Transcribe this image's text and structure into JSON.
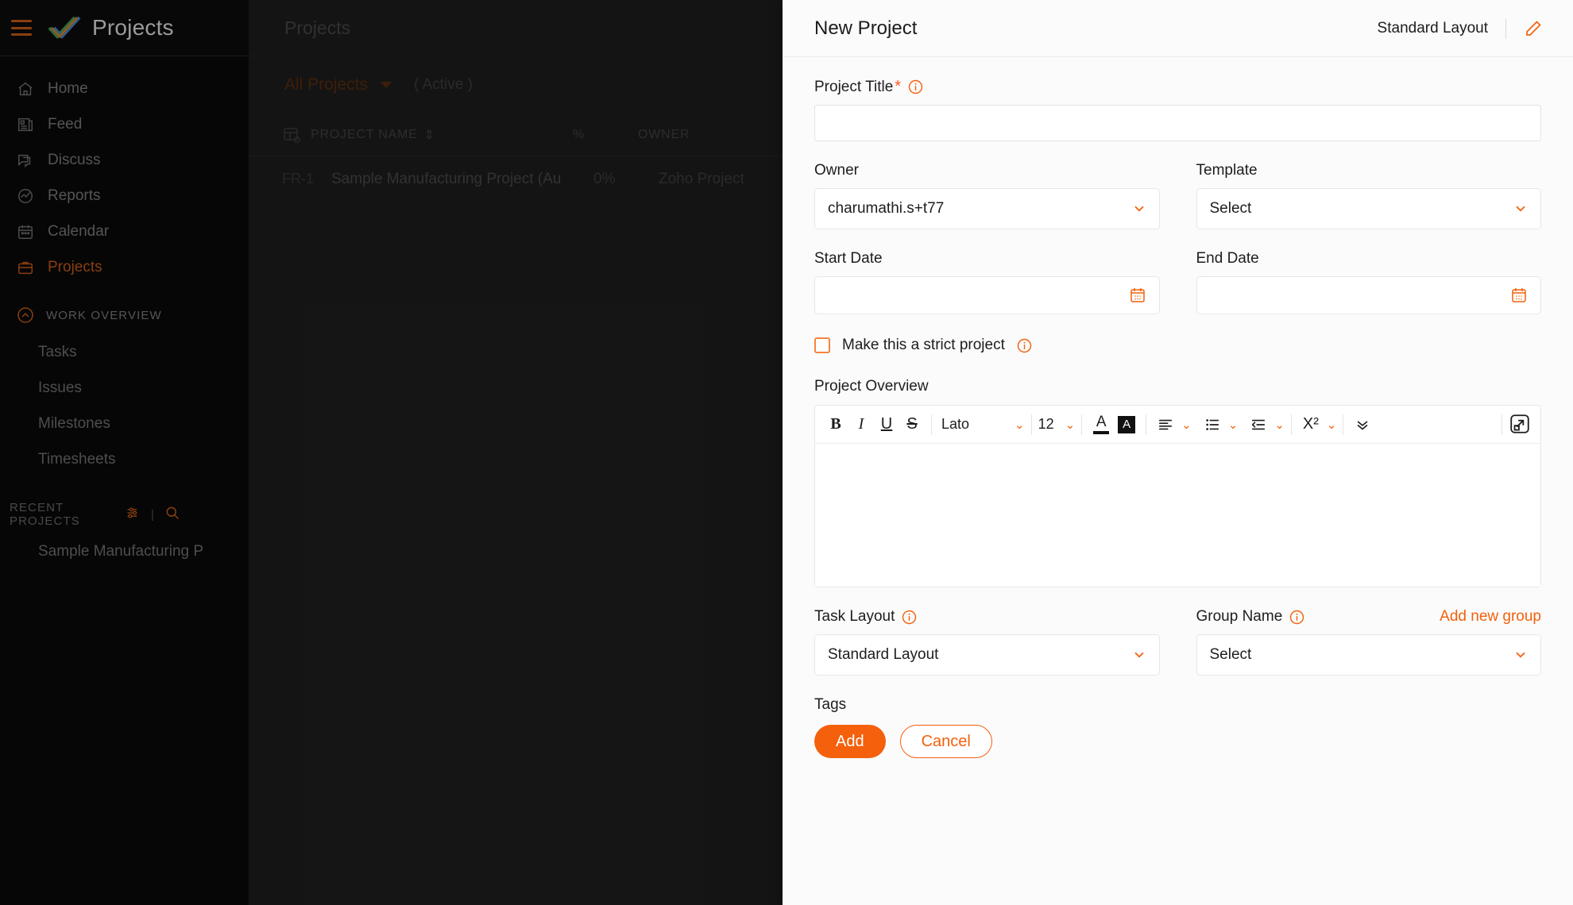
{
  "sidebar": {
    "brand": "Projects",
    "items": [
      {
        "label": "Home",
        "icon": "home-icon"
      },
      {
        "label": "Feed",
        "icon": "feed-icon"
      },
      {
        "label": "Discuss",
        "icon": "discuss-icon"
      },
      {
        "label": "Reports",
        "icon": "reports-icon"
      },
      {
        "label": "Calendar",
        "icon": "calendar-icon"
      },
      {
        "label": "Projects",
        "icon": "projects-icon"
      }
    ],
    "work_overview": {
      "title": "WORK OVERVIEW",
      "items": [
        {
          "label": "Tasks"
        },
        {
          "label": "Issues"
        },
        {
          "label": "Milestones"
        },
        {
          "label": "Timesheets"
        }
      ]
    },
    "recent_projects": {
      "title": "RECENT PROJECTS",
      "filter_icon": "filter-icon",
      "search_icon": "search-icon",
      "divider": "|",
      "items": [
        {
          "label": "Sample Manufacturing P"
        }
      ]
    }
  },
  "content": {
    "header_title": "Projects",
    "filter_label": "All Projects",
    "status_label": "( Active )",
    "table": {
      "columns": [
        {
          "label": "PROJECT NAME",
          "sortable": true
        },
        {
          "label": "%",
          "sortable": false
        },
        {
          "label": "OWNER",
          "sortable": false
        }
      ],
      "rows": [
        {
          "key": "FR-1",
          "name": "Sample Manufacturing Project (Au",
          "percent": "0%",
          "owner": "Zoho Project"
        }
      ]
    }
  },
  "panel": {
    "title": "New Project",
    "layout_name": "Standard Layout",
    "edit_icon": "pencil-icon",
    "fields": {
      "project_title": {
        "label": "Project Title",
        "required_mark": "*",
        "value": "",
        "info_icon": "info-icon"
      },
      "owner": {
        "label": "Owner",
        "value": "charumathi.s+t77"
      },
      "template": {
        "label": "Template",
        "value": "Select"
      },
      "start_date": {
        "label": "Start Date",
        "value": "",
        "calendar_icon": "calendar-icon"
      },
      "end_date": {
        "label": "End Date",
        "value": "",
        "calendar_icon": "calendar-icon"
      },
      "strict_project": {
        "label": "Make this a strict project",
        "checked": false,
        "info_icon": "info-icon"
      },
      "project_overview": {
        "label": "Project Overview",
        "value": ""
      },
      "task_layout": {
        "label": "Task Layout",
        "value": "Standard Layout",
        "info_icon": "info-icon"
      },
      "group_name": {
        "label": "Group Name",
        "value": "Select",
        "info_icon": "info-icon",
        "add_link": "Add new group"
      },
      "tags": {
        "label": "Tags"
      }
    },
    "editor_toolbar": {
      "bold": "B",
      "italic": "I",
      "underline": "U",
      "strike": "S",
      "font_family": "Lato",
      "font_size": "12",
      "text_color": "A",
      "highlight": "A",
      "align_icon": "align-left-icon",
      "list_icon": "bullet-list-icon",
      "indent_icon": "indent-icon",
      "script": "X²",
      "more_icon": "chevron-double-down-icon",
      "expand_icon": "expand-icon"
    },
    "actions": {
      "add": "Add",
      "cancel": "Cancel"
    }
  },
  "colors": {
    "accent": "#f4600c",
    "panel_bg": "#fbfbfb",
    "sidebar_bg": "#060606",
    "content_bg": "#2e2e2e"
  }
}
